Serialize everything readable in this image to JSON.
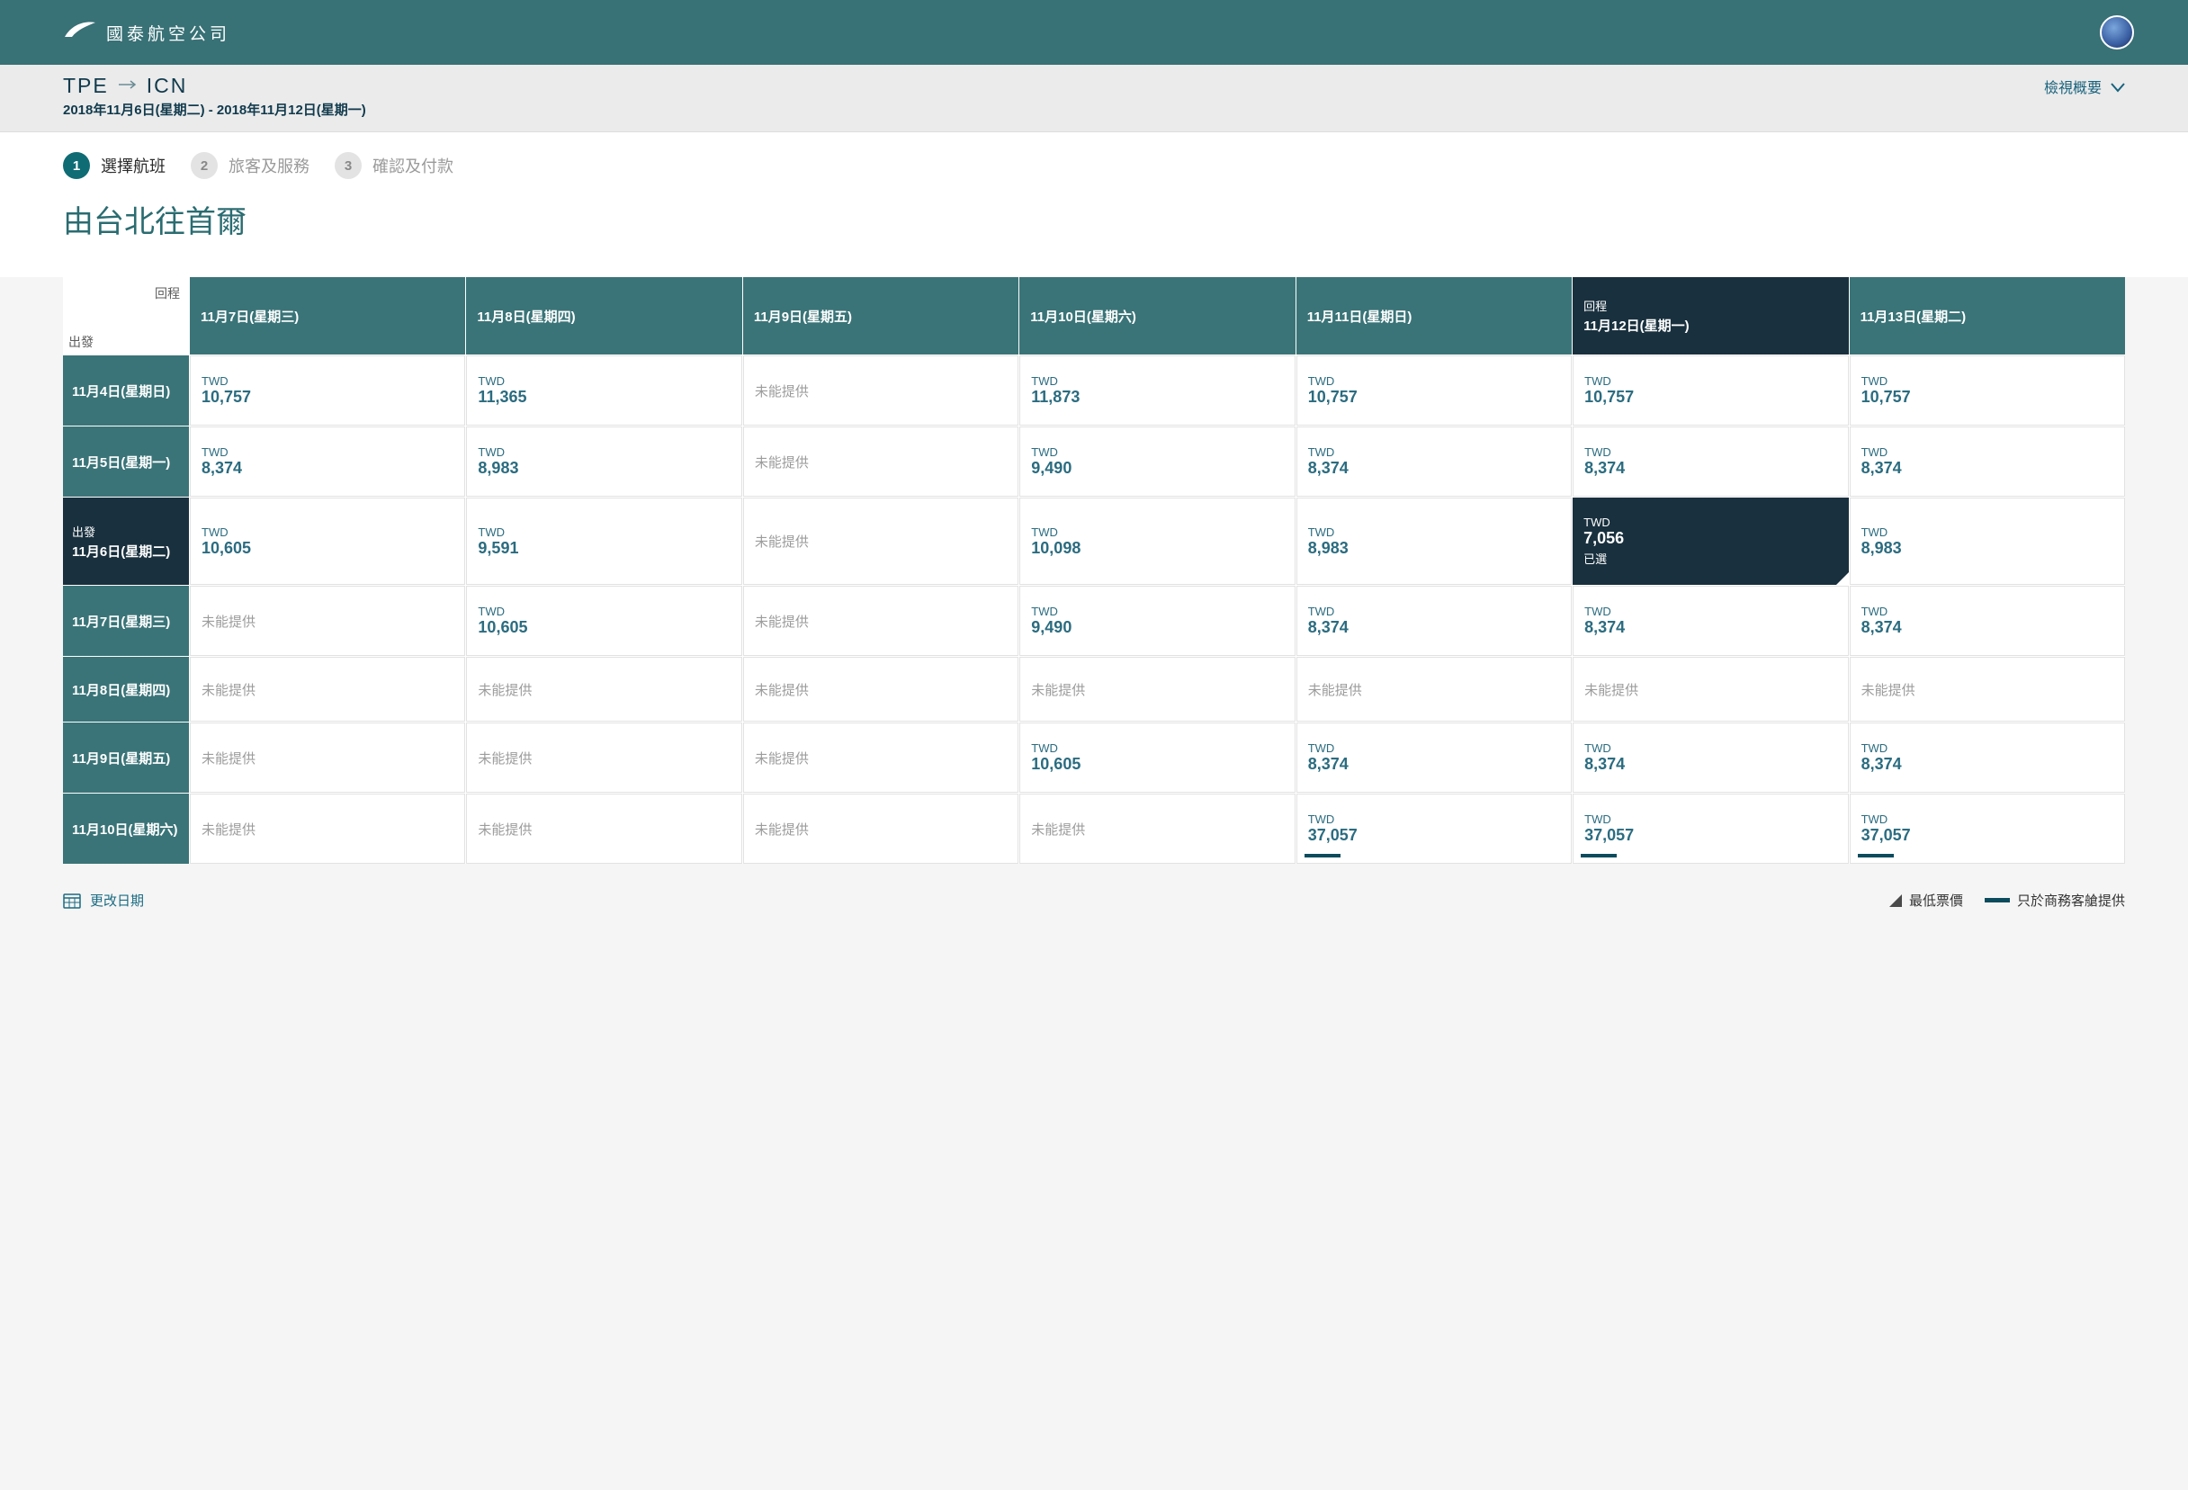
{
  "brand": "國泰航空公司",
  "route": {
    "from": "TPE",
    "to": "ICN",
    "dates": "2018年11月6日(星期二) - 2018年11月12日(星期一)",
    "overview_label": "檢視概要"
  },
  "steps": [
    {
      "num": "1",
      "label": "選擇航班",
      "active": true
    },
    {
      "num": "2",
      "label": "旅客及服務",
      "active": false
    },
    {
      "num": "3",
      "label": "確認及付款",
      "active": false
    }
  ],
  "page_title": "由台北往首爾",
  "matrix": {
    "corner_return": "回程",
    "corner_depart": "出發",
    "currency": "TWD",
    "na_text": "未能提供",
    "selected_text": "已選",
    "return_prefix": "回程",
    "depart_prefix": "出發",
    "columns": [
      {
        "label": "11月7日(星期三)",
        "selected": false
      },
      {
        "label": "11月8日(星期四)",
        "selected": false
      },
      {
        "label": "11月9日(星期五)",
        "selected": false
      },
      {
        "label": "11月10日(星期六)",
        "selected": false
      },
      {
        "label": "11月11日(星期日)",
        "selected": false
      },
      {
        "label": "11月12日(星期一)",
        "selected": true
      },
      {
        "label": "11月13日(星期二)",
        "selected": false
      }
    ],
    "rows": [
      {
        "label": "11月4日(星期日)",
        "selected": false,
        "cells": [
          "10,757",
          "11,365",
          null,
          "11,873",
          "10,757",
          "10,757",
          "10,757"
        ]
      },
      {
        "label": "11月5日(星期一)",
        "selected": false,
        "cells": [
          "8,374",
          "8,983",
          null,
          "9,490",
          "8,374",
          "8,374",
          "8,374"
        ]
      },
      {
        "label": "11月6日(星期二)",
        "selected": true,
        "cells": [
          "10,605",
          "9,591",
          null,
          "10,098",
          "8,983",
          {
            "price": "7,056",
            "selected": true
          },
          "8,983"
        ]
      },
      {
        "label": "11月7日(星期三)",
        "selected": false,
        "cells": [
          null,
          "10,605",
          null,
          "9,490",
          "8,374",
          "8,374",
          "8,374"
        ]
      },
      {
        "label": "11月8日(星期四)",
        "selected": false,
        "cells": [
          null,
          null,
          null,
          null,
          null,
          null,
          null
        ]
      },
      {
        "label": "11月9日(星期五)",
        "selected": false,
        "cells": [
          null,
          null,
          null,
          "10,605",
          "8,374",
          "8,374",
          "8,374"
        ]
      },
      {
        "label": "11月10日(星期六)",
        "selected": false,
        "cells": [
          null,
          null,
          null,
          null,
          {
            "price": "37,057",
            "biz": true
          },
          {
            "price": "37,057",
            "biz": true
          },
          {
            "price": "37,057",
            "biz": true
          }
        ]
      }
    ]
  },
  "footer": {
    "change_date": "更改日期",
    "legend_lowest": "最低票價",
    "legend_biz": "只於商務客艙提供"
  }
}
